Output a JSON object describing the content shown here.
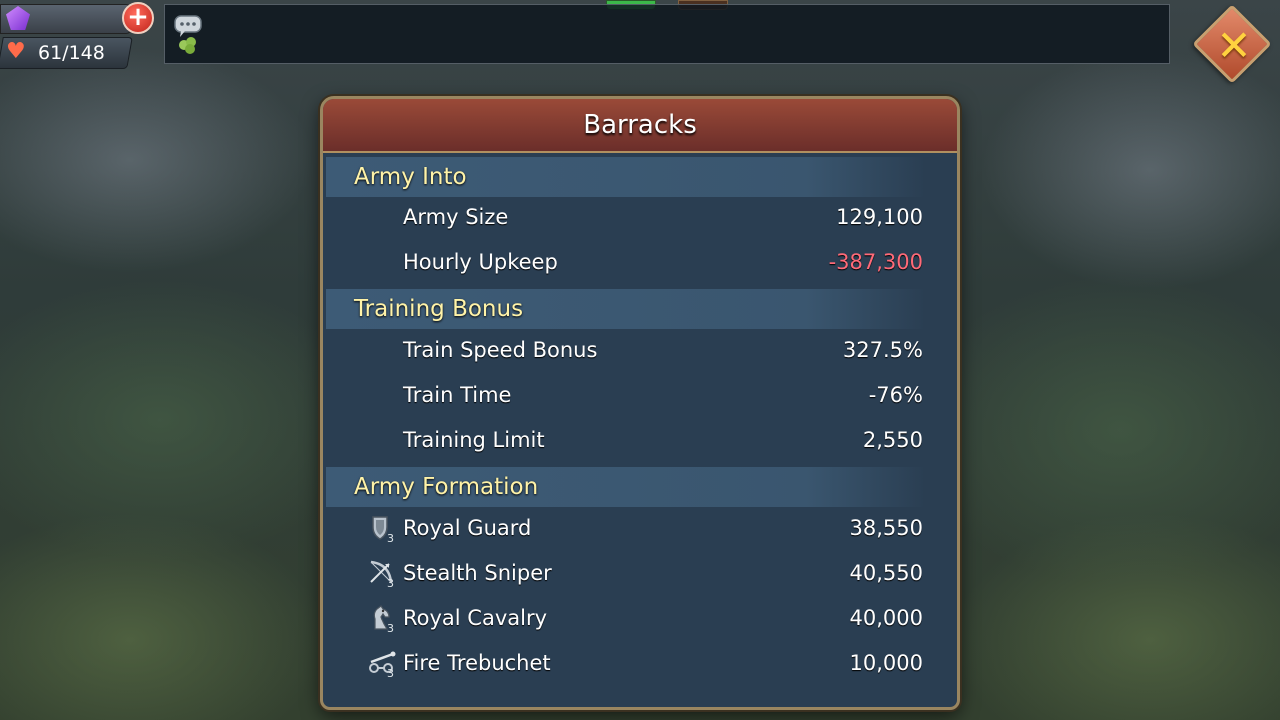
{
  "hud": {
    "stamina": "61/148",
    "icons": [
      "gem-icon",
      "add-gems-button",
      "heart-icon",
      "chat-icon",
      "close-icon"
    ]
  },
  "panel": {
    "title": "Barracks",
    "sections": {
      "army_info": {
        "heading": "Army Into",
        "rows": [
          {
            "label": "Army Size",
            "value": "129,100"
          },
          {
            "label": "Hourly Upkeep",
            "value": "-387,300"
          }
        ]
      },
      "training_bonus": {
        "heading": "Training Bonus",
        "rows": [
          {
            "label": "Train Speed Bonus",
            "value": "327.5%"
          },
          {
            "label": "Train Time",
            "value": "-76%"
          },
          {
            "label": "Training Limit",
            "value": "2,550"
          }
        ]
      },
      "army_formation": {
        "heading": "Army Formation",
        "rows": [
          {
            "label": "Royal Guard",
            "value": "38,550",
            "icon": "shield-tier3-icon"
          },
          {
            "label": "Stealth Sniper",
            "value": "40,550",
            "icon": "bow-tier3-icon"
          },
          {
            "label": "Royal Cavalry",
            "value": "40,000",
            "icon": "horse-tier3-icon"
          },
          {
            "label": "Fire Trebuchet",
            "value": "10,000",
            "icon": "trebuchet-tier3-icon"
          }
        ]
      }
    }
  },
  "colors": {
    "negative_value": "#ff6a78",
    "section_heading": "#fff3a8",
    "panel_bg": "#2a3e52",
    "header_bg": "#8a3e32"
  }
}
